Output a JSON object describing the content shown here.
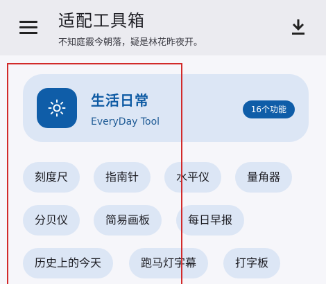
{
  "topbar": {
    "title": "适配工具箱",
    "subtitle": "不知庭霰今朝落，疑是林花昨夜开。",
    "menu_icon": "menu-icon",
    "download_icon": "download-icon"
  },
  "card": {
    "title": "生活日常",
    "subtitle": "EveryDay Tool",
    "badge": "16个功能",
    "icon": "sun-icon"
  },
  "tools": [
    {
      "label": "刻度尺"
    },
    {
      "label": "指南针"
    },
    {
      "label": "水平仪"
    },
    {
      "label": "量角器"
    },
    {
      "label": "分贝仪"
    },
    {
      "label": "简易画板"
    },
    {
      "label": "每日早报"
    },
    {
      "label": "历史上的今天"
    },
    {
      "label": "跑马灯字幕"
    },
    {
      "label": "打字板"
    }
  ],
  "colors": {
    "accent": "#0f5da8",
    "chip_bg": "#dce6f5",
    "highlight": "#d22a2a"
  }
}
